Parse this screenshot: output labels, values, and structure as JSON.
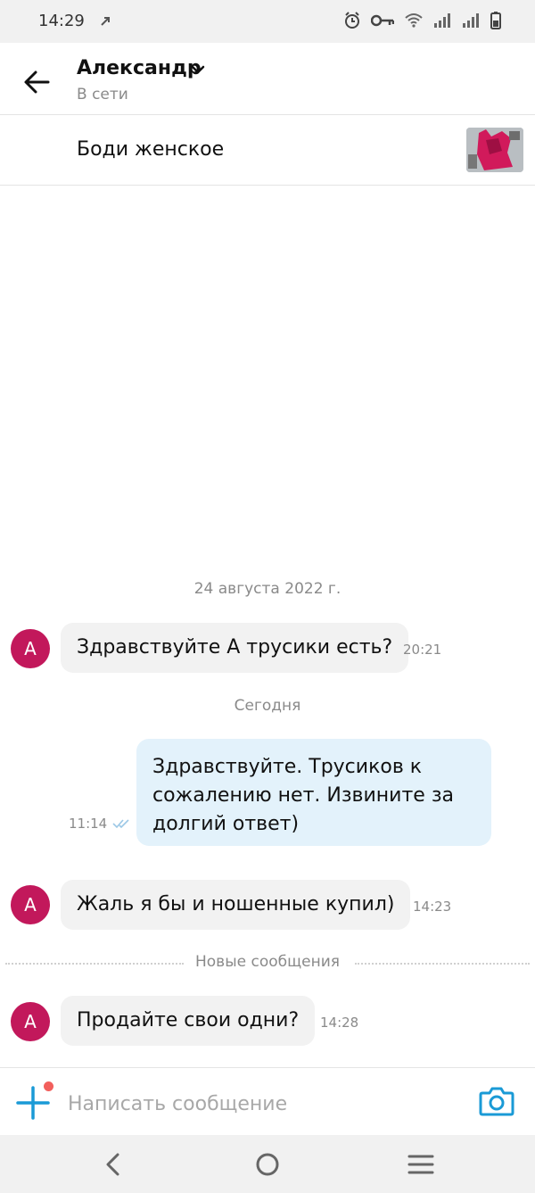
{
  "status_bar": {
    "time": "14:29"
  },
  "header": {
    "contact_name": "Александр",
    "contact_status": "В сети"
  },
  "product": {
    "title": "Боди женское"
  },
  "chat": {
    "date_separator": "24 августа 2022 г.",
    "today_separator": "Сегодня",
    "new_messages_separator": "Новые сообщения",
    "avatar_letter": "А",
    "messages": [
      {
        "direction": "in",
        "text": "Здравствуйте А трусики есть?",
        "time": "20:21"
      },
      {
        "direction": "out",
        "lines": [
          "Здравствуйте. Трусиков к",
          "сожалению нет. Извините за",
          "долгий ответ)"
        ],
        "time": "11:14",
        "status": "read"
      },
      {
        "direction": "in",
        "text": "Жаль я бы и ношенные купил)",
        "time": "14:23"
      },
      {
        "direction": "in",
        "text": "Продайте свои одни?",
        "time": "14:28"
      }
    ]
  },
  "composer": {
    "placeholder": "Написать сообщение",
    "value": ""
  },
  "colors": {
    "avatar": "#c2185b",
    "accent": "#1a9ad6",
    "outgoing_bubble": "#e3f2fb",
    "incoming_bubble": "#f2f2f2",
    "notification_dot": "#f25f5c"
  }
}
